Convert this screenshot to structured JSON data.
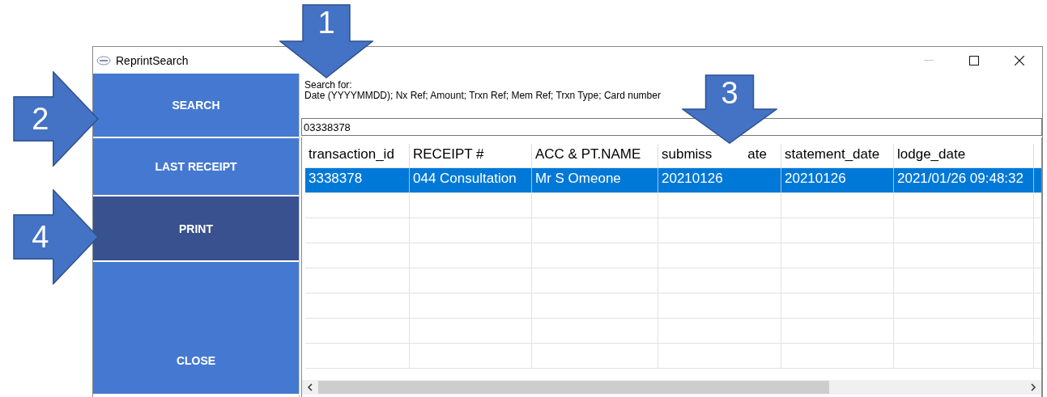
{
  "window": {
    "title": "ReprintSearch"
  },
  "sidebar": {
    "buttons": [
      {
        "label": "SEARCH",
        "selected": false
      },
      {
        "label": "LAST RECEIPT",
        "selected": false
      },
      {
        "label": "PRINT",
        "selected": true
      },
      {
        "label": "CLOSE",
        "selected": false
      }
    ]
  },
  "search": {
    "hint_lines": [
      "Search for:",
      "Date (YYYYMMDD); Nx Ref; Amount; Trxn Ref; Mem Ref; Trxn Type; Card number"
    ],
    "value": "03338378"
  },
  "table": {
    "columns": [
      {
        "label": "transaction_id"
      },
      {
        "label": "RECEIPT #"
      },
      {
        "label": "ACC & PT.NAME"
      },
      {
        "label_start": "submiss",
        "label_end": "ate"
      },
      {
        "label": "statement_date"
      },
      {
        "label": "lodge_date"
      }
    ],
    "rows": [
      {
        "selected": true,
        "cells": [
          "3338378",
          "044 Consultation",
          "Mr S Omeone",
          "20210126",
          "20210126",
          "2021/01/26 09:48:32"
        ]
      }
    ]
  },
  "callouts": [
    {
      "label": "1",
      "kind": "down"
    },
    {
      "label": "2",
      "kind": "right"
    },
    {
      "label": "3",
      "kind": "down"
    },
    {
      "label": "4",
      "kind": "right"
    }
  ]
}
